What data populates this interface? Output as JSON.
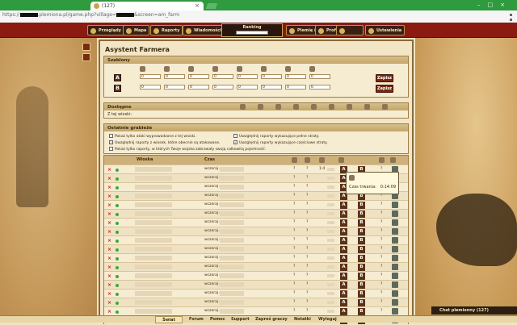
{
  "browser": {
    "tab_title": "(127)",
    "url_prefix": "https://",
    "url_mid1": ".plemiona.pl/game.php?village=",
    "url_mid2": "&screen=am_farm"
  },
  "nav": {
    "przeglady": "Przeglądy",
    "mapa": "Mapa",
    "raporty": "Raporty",
    "wiadomosci": "Wiadomości",
    "ranking": "Ranking",
    "plemie": "Plemię (3)",
    "profil": "Profil",
    "ustawienia": "Ustawienia"
  },
  "page": {
    "title": "Asystent Farmera",
    "szablony": "Szablony",
    "template_a": "A",
    "template_b": "B",
    "save": "Zapisz",
    "inp_val": "0",
    "dostepne": "Dostępne",
    "z_tej_wioski": "Z tej wioski:",
    "ostatnie": "Ostatnie grabieże"
  },
  "options": [
    {
      "label": "Pokaż tylko ataki wyprowadzone z tej wioski.",
      "checked": false
    },
    {
      "label": "Uwzględnij raporty z wiosek, które obecnie są atakowane.",
      "checked": true
    },
    {
      "label": "Pokaż tylko raporty, w których Twoje wojska zabrawały swoją całkowitą pojemność.",
      "checked": false
    },
    {
      "label": "Uwzględnij raporty wykazujące pełne straty.",
      "checked": false
    },
    {
      "label": "Uwzględnij raporty wykazujące częściowe straty.",
      "checked": true
    }
  ],
  "table": {
    "col_wioska": "Wioska",
    "col_czas": "Czas",
    "row_czas": "wczoraj o",
    "q": "?",
    "first_ratio": "1:4",
    "btn_a": "A",
    "btn_b": "B"
  },
  "tooltip": {
    "label": "Czas trwania:",
    "value": "0:14:09"
  },
  "footer": {
    "swiat": "Świat",
    "forum": "Forum",
    "pomoc": "Pomoc",
    "support": "Support",
    "zapros": "Zaproś graczy",
    "notatki": "Notatki",
    "wyloguj": "Wyloguj",
    "chat": "Chat plemienny (127)"
  }
}
